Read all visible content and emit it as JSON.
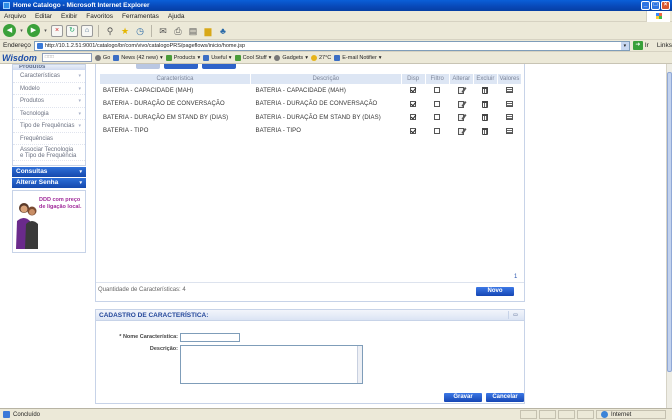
{
  "window": {
    "title": "Home Catalogo - Microsoft Internet Explorer"
  },
  "menu": [
    "Arquivo",
    "Editar",
    "Exibir",
    "Favoritos",
    "Ferramentas",
    "Ajuda"
  ],
  "address": {
    "label": "Endereço",
    "url": "http://10.1.2.51:9001/catalogo/br/com/vivo/catalogoPRS/pageflows/inicio/home.jsp",
    "go": "Ir",
    "links": "Links"
  },
  "wisdom": {
    "brand": "Wisdom",
    "search_placeholder": "□□□",
    "go": "Go",
    "items": [
      "News (42 new)",
      "Products",
      "Useful",
      "Cool Stuff",
      "Gadgets",
      "27°C",
      "E-mail Notifier"
    ]
  },
  "sidebar": {
    "header": "Produtos",
    "items": [
      "Características",
      "Modelo",
      "Produtos",
      "Tecnologia",
      "Tipo de Frequências",
      "Frequências"
    ],
    "item_two_line": [
      "Associar Tecnologia",
      "e Tipo de Frequência"
    ],
    "sections": [
      "Consultas",
      "Alterar Senha"
    ],
    "promo": "DDD com preço de ligação local."
  },
  "grid": {
    "headers": {
      "name": "Característica",
      "desc": "Descrição",
      "disp": "Disp",
      "filtro": "Filtro",
      "alterar": "Alterar",
      "excluir": "Excluir",
      "valores": "Valores"
    },
    "rows": [
      {
        "name": "BATERIA - CAPACIDADE (MAH)",
        "desc": "BATERIA - CAPACIDADE (MAH)",
        "disp": true,
        "filtro": false
      },
      {
        "name": "BATERIA - DURAÇÃO DE CONVERSAÇÃO",
        "desc": "BATERIA - DURAÇÃO DE CONVERSAÇÃO",
        "disp": true,
        "filtro": false
      },
      {
        "name": "BATERIA - DURAÇÃO EM STAND BY (DIAS)",
        "desc": "BATERIA - DURAÇÃO EM STAND BY (DIAS)",
        "disp": true,
        "filtro": false
      },
      {
        "name": "BATERIA - TIPO",
        "desc": "BATERIA - TIPO",
        "disp": true,
        "filtro": false
      }
    ],
    "page": "1",
    "quantity": "Quantidade de Características: 4",
    "new_button": "Novo"
  },
  "form": {
    "title": "CADASTRO DE CARACTERÍSTICA:",
    "name_label": "* Nome Característica:",
    "desc_label": "Descrição:",
    "name_value": "",
    "desc_value": "",
    "save": "Gravar",
    "cancel": "Cancelar"
  },
  "status": {
    "text": "Concluído",
    "zone": "Internet"
  }
}
